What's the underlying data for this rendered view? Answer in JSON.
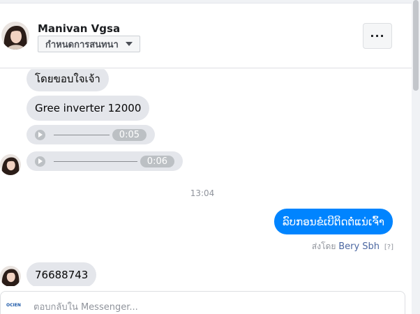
{
  "header": {
    "contact_name": "Manivan Vgsa",
    "conversation_menu_label": "กำหนดการสนทนา",
    "more_label": "···"
  },
  "messages": {
    "incoming": [
      {
        "text": "โดยขอบใจเจ้า"
      },
      {
        "text": "Gree inverter 12000"
      }
    ],
    "audio_clips": [
      {
        "duration": "0:05"
      },
      {
        "duration": "0:06"
      }
    ],
    "timestamp": "13:04",
    "outgoing": {
      "text": "ລົບກອນຂໍເບີຕິດຕໍ່ແນ່ເຈົ້າ"
    },
    "sent_by": {
      "prefix": "ส่งโดย",
      "sender": "Bery Sbh",
      "help": "[?]"
    },
    "last_incoming": {
      "text": "76688743"
    }
  },
  "composer": {
    "logo_text": "OCIEN",
    "placeholder": "ตอบกลับใน Messenger..."
  },
  "colors": {
    "accent": "#0084ff",
    "incoming_bubble": "#e4e6eb",
    "sender_link": "#4b67a1"
  },
  "icons": {
    "avatar": "person-photo",
    "play": "play-icon",
    "caret": "chevron-down-icon",
    "more": "more-horizontal-icon"
  }
}
